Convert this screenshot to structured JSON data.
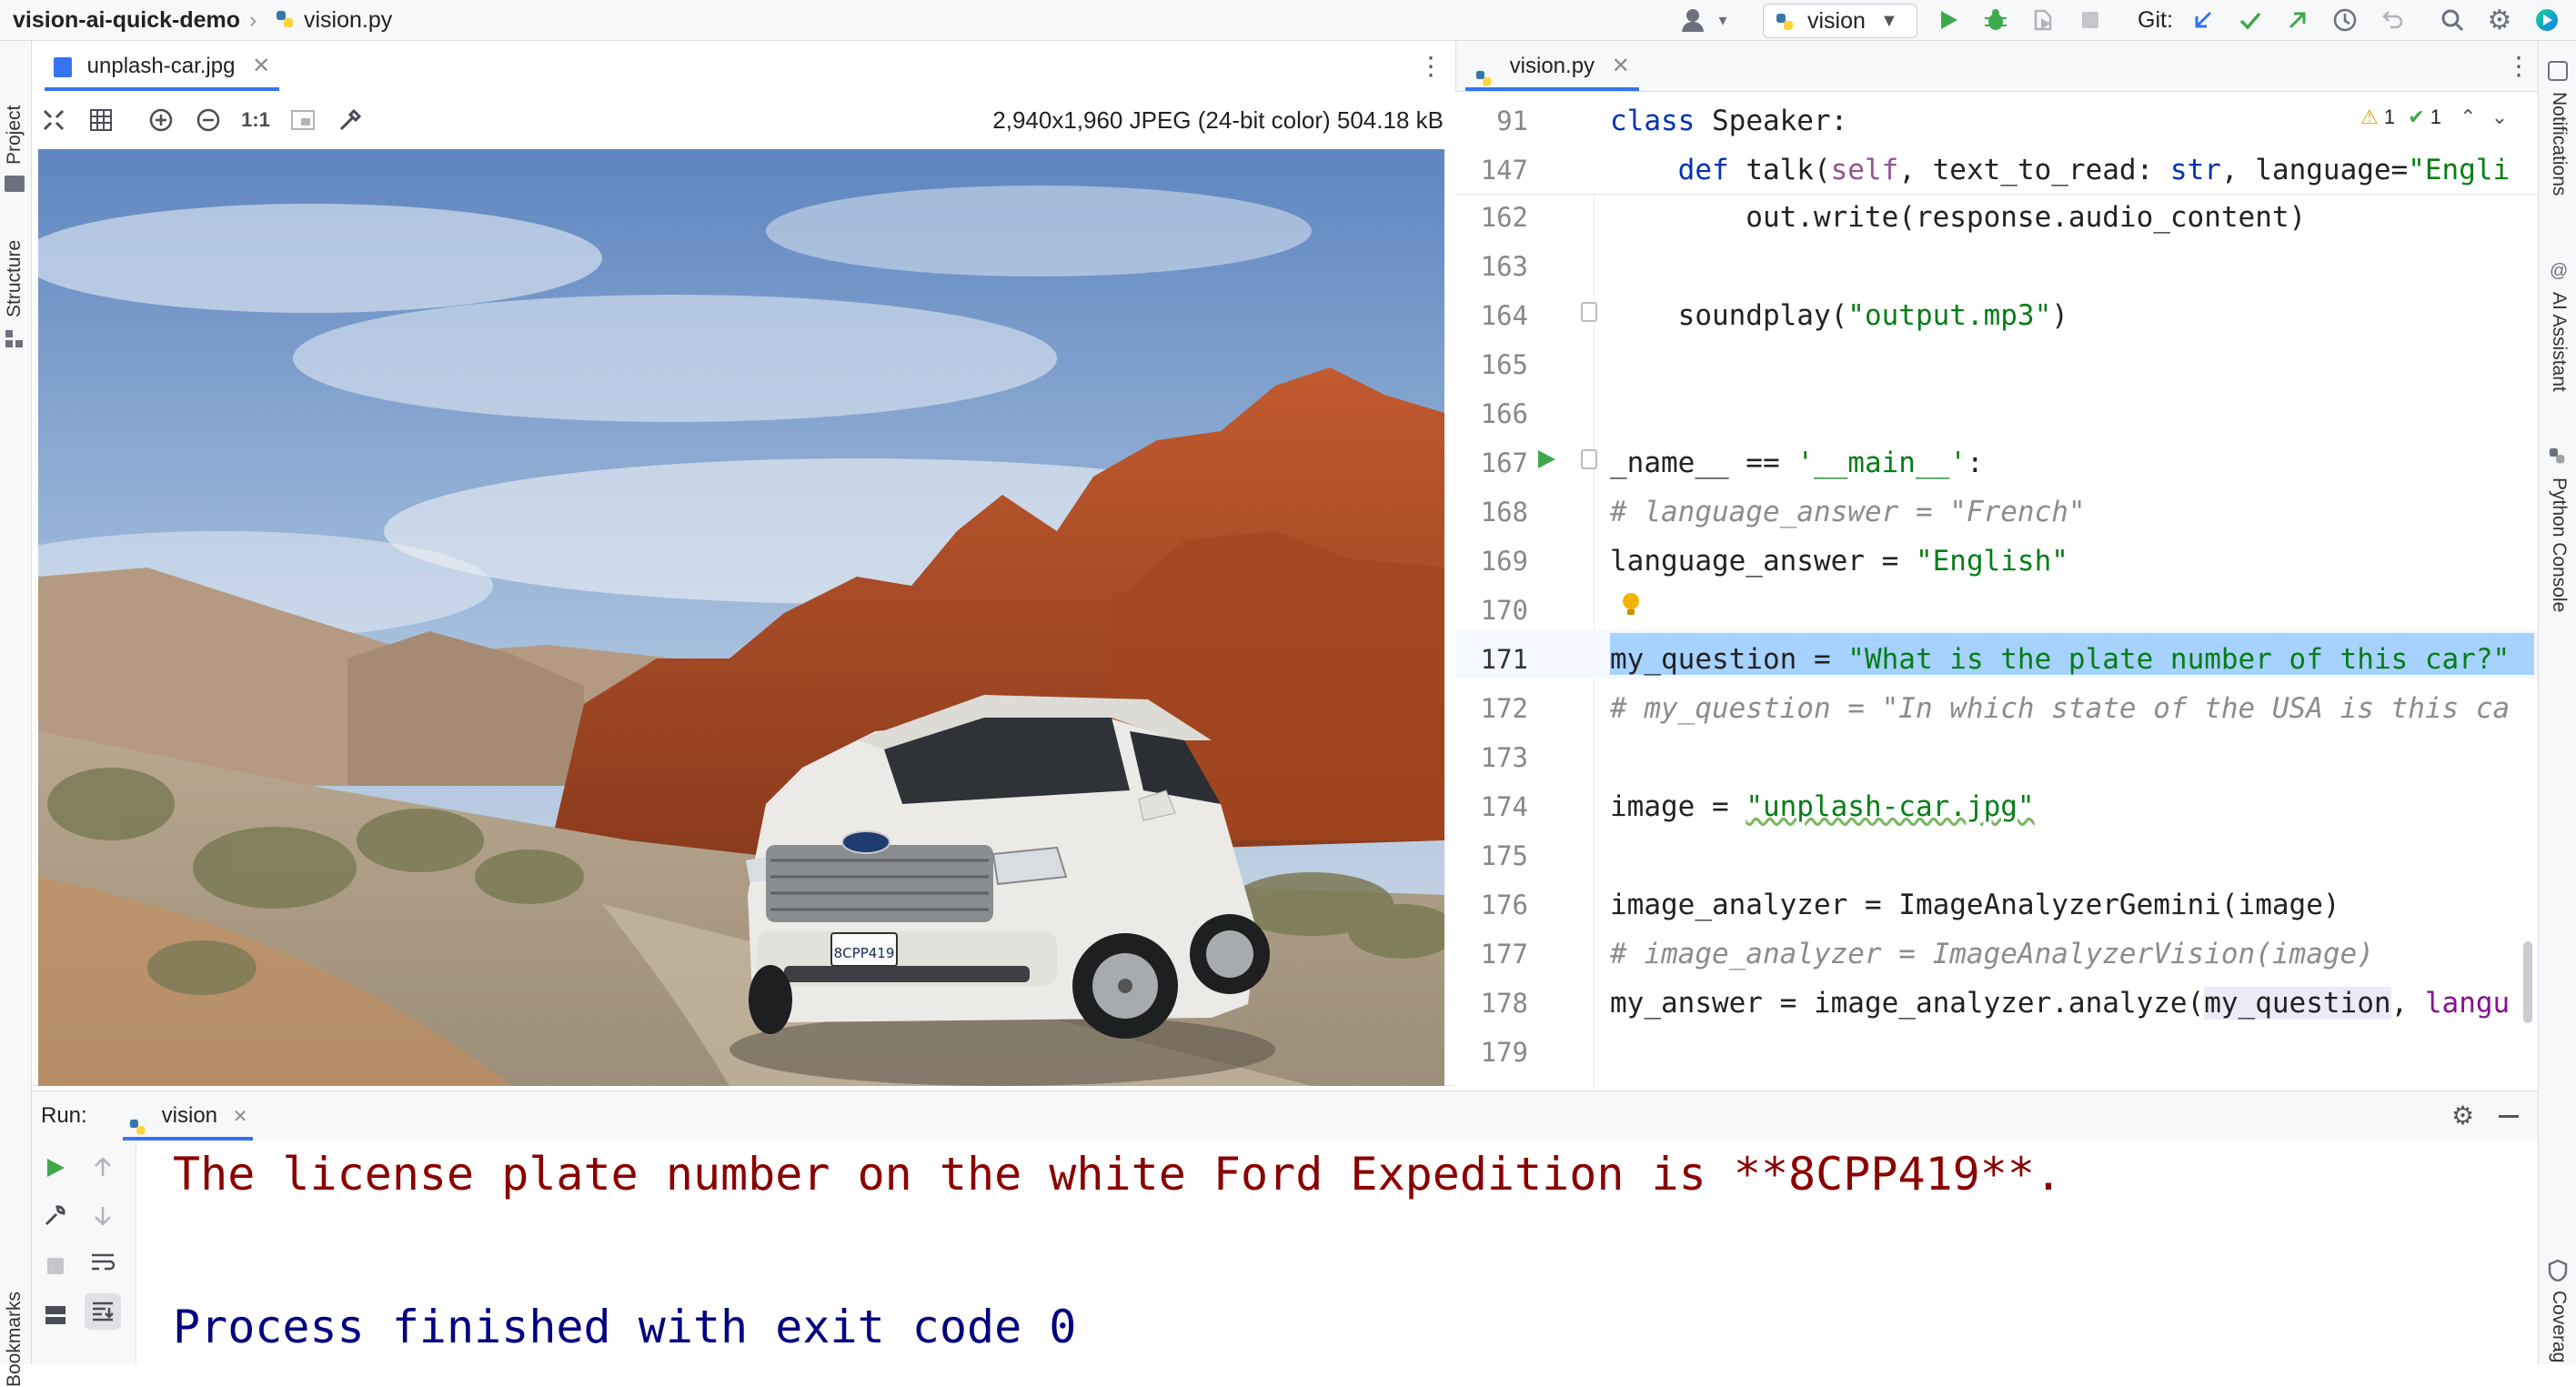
{
  "topbar": {
    "project": "vision-ai-quick-demo",
    "file": "vision.py",
    "run_config": "vision",
    "git_label": "Git:"
  },
  "left_strip": {
    "project": "Project",
    "structure": "Structure",
    "bookmarks": "Bookmarks"
  },
  "right_strip": {
    "notifications": "Notifications",
    "ai_assistant": "AI Assistant",
    "python_console": "Python Console",
    "coverage": "Coverag"
  },
  "image_viewer": {
    "tab": "unplash-car.jpg",
    "zoom_actual": "1:1",
    "info": "2,940x1,960 JPEG (24-bit color) 504.18 kB",
    "plate_text": "8CPP419"
  },
  "editor": {
    "tab": "vision.py",
    "inspections": {
      "warnings": "1",
      "ok": "1"
    },
    "sticky": [
      {
        "ln": "91",
        "code": "class Speaker:"
      },
      {
        "ln": "147",
        "code": "    def talk(self, text_to_read: str, language=\"Engli"
      }
    ],
    "lines": [
      {
        "ln": "162",
        "code": "        out.write(response.audio_content)"
      },
      {
        "ln": "163",
        "code": ""
      },
      {
        "ln": "164",
        "code": "    soundplay(\"output.mp3\")"
      },
      {
        "ln": "165",
        "code": ""
      },
      {
        "ln": "166",
        "code": ""
      },
      {
        "ln": "167",
        "code": "_name__ == '__main__':"
      },
      {
        "ln": "168",
        "code": "# language_answer = \"French\""
      },
      {
        "ln": "169",
        "code": "language_answer = \"English\""
      },
      {
        "ln": "170",
        "code": ""
      },
      {
        "ln": "171",
        "code": "my_question = \"What is the plate number of this car?\""
      },
      {
        "ln": "172",
        "code": "# my_question = \"In which state of the USA is this ca"
      },
      {
        "ln": "173",
        "code": ""
      },
      {
        "ln": "174",
        "code": "image = \"unplash-car.jpg\""
      },
      {
        "ln": "175",
        "code": ""
      },
      {
        "ln": "176",
        "code": "image_analyzer = ImageAnalyzerGemini(image)"
      },
      {
        "ln": "177",
        "code": "# image_analyzer = ImageAnalyzerVision(image)"
      },
      {
        "ln": "178",
        "code": "my_answer = image_analyzer.analyze(my_question, langu"
      },
      {
        "ln": "179",
        "code": ""
      }
    ]
  },
  "run": {
    "label": "Run:",
    "tab": "vision",
    "output": [
      "The license plate number on the white Ford Expedition is **8CPP419**.",
      "",
      "Process finished with exit code 0"
    ]
  },
  "colors": {
    "accent": "#3574f0",
    "selection": "#a6d2ff",
    "console_red": "#8b0000",
    "console_blue": "#000080"
  }
}
